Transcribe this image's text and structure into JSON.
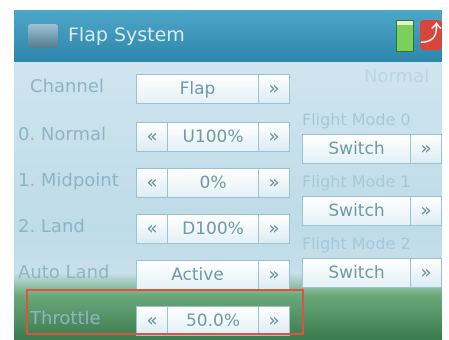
{
  "title": "Flap System",
  "icons": {
    "app": "plane-icon",
    "battery": "battery-icon",
    "exit": "exit-icon"
  },
  "status_text": "Normal",
  "arrows": {
    "left": "«",
    "right": "»"
  },
  "exit_glyph": "⤴",
  "rows": [
    {
      "label": "Channel",
      "value": "Flap"
    },
    {
      "label": "0. Normal",
      "value": "U100%"
    },
    {
      "label": "1. Midpoint",
      "value": "0%"
    },
    {
      "label": "2. Land",
      "value": "D100%"
    },
    {
      "label": "Auto Land",
      "value": "Active"
    },
    {
      "label": "Throttle",
      "value": "50.0%"
    }
  ],
  "flight_modes": [
    {
      "label": "Flight Mode 0",
      "button": "Switch"
    },
    {
      "label": "Flight Mode 1",
      "button": "Switch"
    },
    {
      "label": "Flight Mode 2",
      "button": "Switch"
    }
  ],
  "colors": {
    "titlebar": "#2f86ac",
    "highlight": "#e1523d",
    "battery": "#7bd05c",
    "exit": "#d8453b"
  }
}
